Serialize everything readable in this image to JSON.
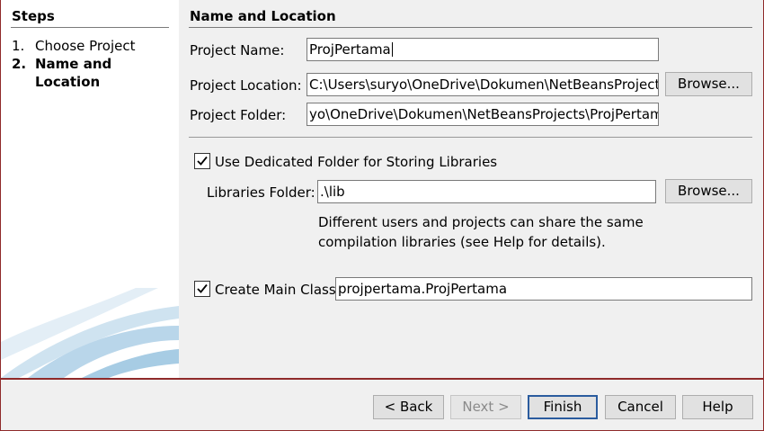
{
  "steps": {
    "title": "Steps",
    "items": [
      {
        "num": "1.",
        "label": "Choose Project"
      },
      {
        "num": "2.",
        "label": "Name and Location"
      }
    ]
  },
  "section": {
    "title": "Name and Location"
  },
  "project_name": {
    "label": "Project Name:",
    "value": "ProjPertama"
  },
  "project_location": {
    "label": "Project Location:",
    "value": "C:\\Users\\suryo\\OneDrive\\Dokumen\\NetBeansProjects",
    "browse_label": "Browse..."
  },
  "project_folder": {
    "label": "Project Folder:",
    "value": "yo\\OneDrive\\Dokumen\\NetBeansProjects\\ProjPertama"
  },
  "dedicated_folder": {
    "label": "Use Dedicated Folder for Storing Libraries",
    "checked": true
  },
  "libraries_folder": {
    "label": "Libraries Folder:",
    "value": ".\\lib",
    "browse_label": "Browse...",
    "help_line1": "Different users and projects can share the same",
    "help_line2": "compilation libraries (see Help for details)."
  },
  "main_class": {
    "label": "Create Main Class",
    "checked": true,
    "value": "projpertama.ProjPertama"
  },
  "buttons": {
    "back": "< Back",
    "next": "Next >",
    "finish": "Finish",
    "cancel": "Cancel",
    "help": "Help"
  },
  "colors": {
    "accent_border": "#8f2a2a",
    "default_button_border": "#2b5c9e"
  }
}
